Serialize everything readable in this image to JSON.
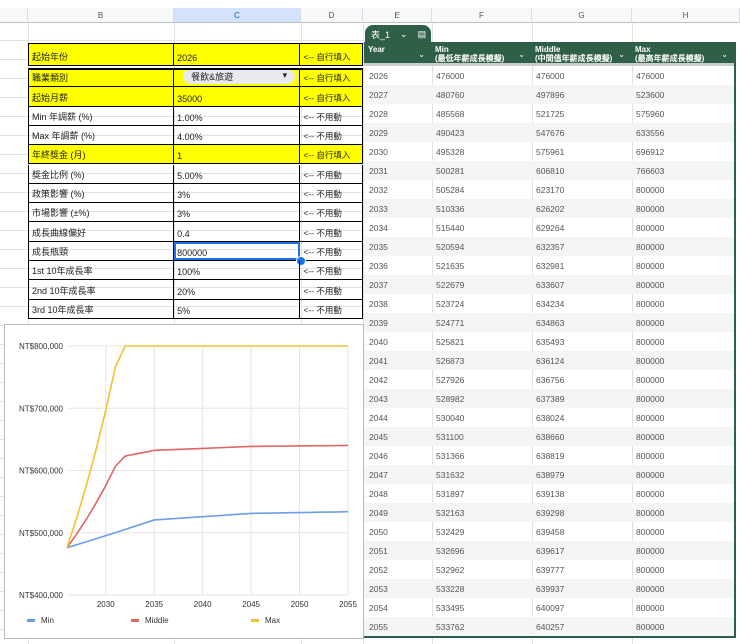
{
  "columns": [
    "B",
    "C",
    "D",
    "E",
    "F",
    "G",
    "H"
  ],
  "params": [
    {
      "label": "起始年份",
      "value": "2026",
      "note": "<-- 自行填入",
      "yellow": true
    },
    {
      "label": "職業類別",
      "value": "餐飲&旅遊",
      "note": "<-- 自行填入",
      "yellow": true,
      "dropdown": true
    },
    {
      "label": "起始月薪",
      "value": "35000",
      "note": "<-- 自行填入",
      "yellow": true
    },
    {
      "label": "Min 年調薪 (%)",
      "value": "1.00%",
      "note": "<-- 不用動"
    },
    {
      "label": "Max 年調薪 (%)",
      "value": "4.00%",
      "note": "<-- 不用動"
    },
    {
      "label": "年終獎金 (月)",
      "value": "1",
      "note": "<-- 自行填入",
      "yellow": true
    },
    {
      "label": "獎金比例 (%)",
      "value": "5.00%",
      "note": "<-- 不用動"
    },
    {
      "label": "政策影響 (%)",
      "value": "3%",
      "note": "<-- 不用動"
    },
    {
      "label": "市場影響 (±%)",
      "value": "3%",
      "note": "<-- 不用動"
    },
    {
      "label": "成長曲線偏好",
      "value": "0.4",
      "note": "<-- 不用動"
    },
    {
      "label": "成長瓶頸",
      "value": "800000",
      "note": "<-- 不用動",
      "selected": true
    },
    {
      "label": "1st 10年成長率",
      "value": "100%",
      "note": "<-- 不用動"
    },
    {
      "label": "2nd 10年成長率",
      "value": "20%",
      "note": "<-- 不用動"
    },
    {
      "label": "3rd 10年成長率",
      "value": "5%",
      "note": "<-- 不用動"
    }
  ],
  "table": {
    "name": "表_1",
    "headers": [
      [
        "Year",
        ""
      ],
      [
        "Min",
        "(最低年薪成長模擬)"
      ],
      [
        "Middle",
        "(中間值年薪成長模擬)"
      ],
      [
        "Max",
        "(最高年薪成長模擬)"
      ]
    ],
    "rows": [
      [
        "2026",
        "476000",
        "476000",
        "476000"
      ],
      [
        "2027",
        "480760",
        "497896",
        "523600"
      ],
      [
        "2028",
        "485568",
        "521725",
        "575960"
      ],
      [
        "2029",
        "490423",
        "547676",
        "633556"
      ],
      [
        "2030",
        "495328",
        "575961",
        "696912"
      ],
      [
        "2031",
        "500281",
        "606810",
        "766603"
      ],
      [
        "2032",
        "505284",
        "623170",
        "800000"
      ],
      [
        "2033",
        "510336",
        "626202",
        "800000"
      ],
      [
        "2034",
        "515440",
        "629264",
        "800000"
      ],
      [
        "2035",
        "520594",
        "632357",
        "800000"
      ],
      [
        "2036",
        "521635",
        "632981",
        "800000"
      ],
      [
        "2037",
        "522679",
        "633607",
        "800000"
      ],
      [
        "2038",
        "523724",
        "634234",
        "800000"
      ],
      [
        "2039",
        "524771",
        "634863",
        "800000"
      ],
      [
        "2040",
        "525821",
        "635493",
        "800000"
      ],
      [
        "2041",
        "526873",
        "636124",
        "800000"
      ],
      [
        "2042",
        "527926",
        "636756",
        "800000"
      ],
      [
        "2043",
        "528982",
        "637389",
        "800000"
      ],
      [
        "2044",
        "530040",
        "638024",
        "800000"
      ],
      [
        "2045",
        "531100",
        "638660",
        "800000"
      ],
      [
        "2046",
        "531366",
        "638819",
        "800000"
      ],
      [
        "2047",
        "531632",
        "638979",
        "800000"
      ],
      [
        "2048",
        "531897",
        "639138",
        "800000"
      ],
      [
        "2049",
        "532163",
        "639298",
        "800000"
      ],
      [
        "2050",
        "532429",
        "639458",
        "800000"
      ],
      [
        "2051",
        "532696",
        "639617",
        "800000"
      ],
      [
        "2052",
        "532962",
        "639777",
        "800000"
      ],
      [
        "2053",
        "533228",
        "639937",
        "800000"
      ],
      [
        "2054",
        "533495",
        "640097",
        "800000"
      ],
      [
        "2055",
        "533762",
        "640257",
        "800000"
      ]
    ]
  },
  "chart_data": {
    "type": "line",
    "x": [
      2026,
      2027,
      2028,
      2029,
      2030,
      2031,
      2032,
      2033,
      2034,
      2035,
      2036,
      2037,
      2038,
      2039,
      2040,
      2041,
      2042,
      2043,
      2044,
      2045,
      2046,
      2047,
      2048,
      2049,
      2050,
      2051,
      2052,
      2053,
      2054,
      2055
    ],
    "series": [
      {
        "name": "Min",
        "color": "#6d9eeb",
        "values": [
          476000,
          480760,
          485568,
          490423,
          495328,
          500281,
          505284,
          510336,
          515440,
          520594,
          521635,
          522679,
          523724,
          524771,
          525821,
          526873,
          527926,
          528982,
          530040,
          531100,
          531366,
          531632,
          531897,
          532163,
          532429,
          532696,
          532962,
          533228,
          533495,
          533762
        ]
      },
      {
        "name": "Middle",
        "color": "#e06666",
        "values": [
          476000,
          497896,
          521725,
          547676,
          575961,
          606810,
          623170,
          626202,
          629264,
          632357,
          632981,
          633607,
          634234,
          634863,
          635493,
          636124,
          636756,
          637389,
          638024,
          638660,
          638819,
          638979,
          639138,
          639298,
          639458,
          639617,
          639777,
          639937,
          640097,
          640257
        ]
      },
      {
        "name": "Max",
        "color": "#f1c232",
        "values": [
          476000,
          523600,
          575960,
          633556,
          696912,
          766603,
          800000,
          800000,
          800000,
          800000,
          800000,
          800000,
          800000,
          800000,
          800000,
          800000,
          800000,
          800000,
          800000,
          800000,
          800000,
          800000,
          800000,
          800000,
          800000,
          800000,
          800000,
          800000,
          800000,
          800000
        ]
      }
    ],
    "ylim": [
      400000,
      800000
    ],
    "yticks": [
      "NT$400,000",
      "NT$500,000",
      "NT$600,000",
      "NT$700,000",
      "NT$800,000"
    ],
    "xticks": [
      "2030",
      "2035",
      "2040",
      "2045",
      "2050",
      "2055"
    ],
    "grid": true,
    "legend": "bottom"
  }
}
